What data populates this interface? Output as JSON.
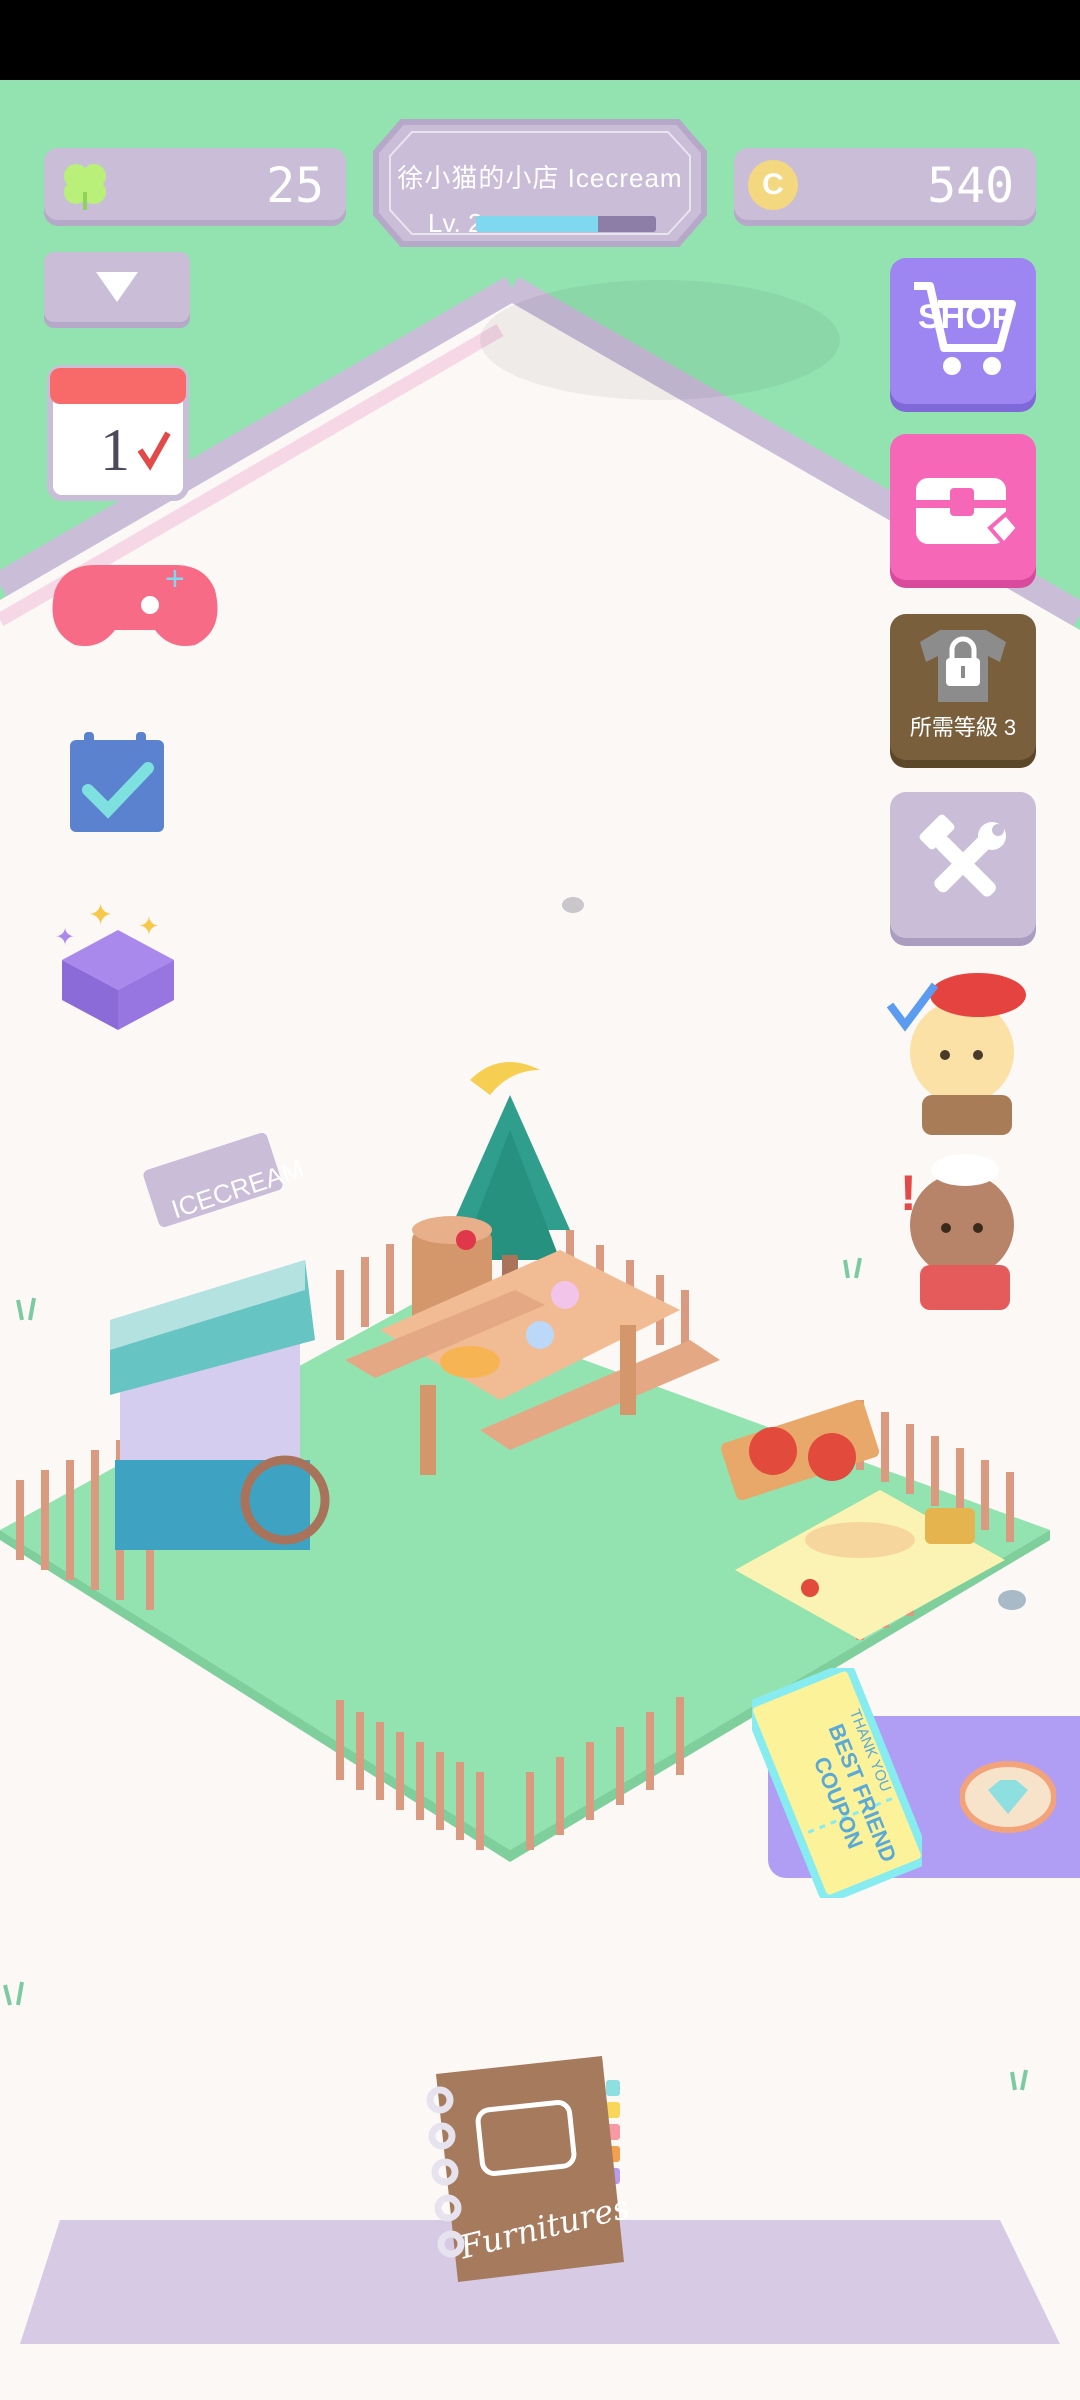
{
  "hud": {
    "lives": "25",
    "coins": "540",
    "shop_name": "徐小猫的小店 Icecream",
    "level_label": "Lv. 2",
    "xp_progress": 0.68
  },
  "side_buttons": {
    "shop_label": "SHOP",
    "locked_label": "所需等級 3"
  },
  "scene": {
    "cart_sign": "ICECREAM",
    "coupon_text": "BEST FRIEND COUPON",
    "coupon_thank": "THANK YOU",
    "book_label": "Furnitures"
  },
  "colors": {
    "grass": "#93e3b0",
    "purple_ui": "#c9bdd8",
    "shop_purple": "#9d86f2",
    "chest_pink": "#f767b8",
    "locked_brown": "#7a5f3c"
  }
}
